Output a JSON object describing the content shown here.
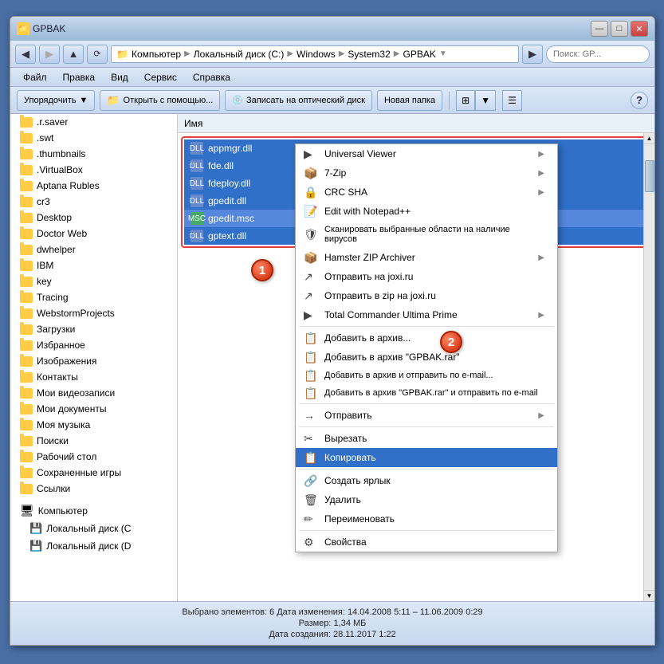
{
  "window": {
    "title": "GPBAK",
    "titlebar_buttons": {
      "minimize": "—",
      "maximize": "□",
      "close": "✕"
    }
  },
  "addressbar": {
    "path_segments": [
      "Компьютер",
      "Локальный диск (C:)",
      "Windows",
      "System32",
      "GPBAK"
    ],
    "search_placeholder": "Поиск: GP..."
  },
  "menu": {
    "items": [
      "Файл",
      "Правка",
      "Вид",
      "Сервис",
      "Справка"
    ]
  },
  "toolbar": {
    "organize": "Упорядочить",
    "open_with": "Открыть с помощью...",
    "burn": "Записать на оптический диск",
    "new_folder": "Новая папка",
    "help": "?"
  },
  "sidebar": {
    "items": [
      ".r.saver",
      ".swt",
      ".thumbnails",
      ".VirtualBox",
      "Aptana Rubles",
      "cr3",
      "Desktop",
      "Doctor Web",
      "dwhelper",
      "IBM",
      "key",
      "Tracing",
      "WebstormProjects",
      "Загрузки",
      "Избранное",
      "Изображения",
      "Контакты",
      "Мои видеозаписи",
      "Мои документы",
      "Моя музыка",
      "Поиски",
      "Рабочий стол",
      "Сохраненные игры",
      "Ссылки"
    ],
    "computer": "Компьютер",
    "drives": [
      "Локальный диск (C",
      "Локальный диск (D"
    ]
  },
  "file_list": {
    "column_header": "Имя",
    "files": [
      {
        "name": "appmgr.dll",
        "type": "dll",
        "selected": true
      },
      {
        "name": "fde.dll",
        "type": "dll",
        "selected": true
      },
      {
        "name": "fdeploy.dll",
        "type": "dll",
        "selected": true
      },
      {
        "name": "gpedit.dll",
        "type": "dll",
        "selected": true
      },
      {
        "name": "gpedit.msc",
        "type": "msc",
        "selected": true
      },
      {
        "name": "gptext.dll",
        "type": "dll",
        "selected": true
      }
    ]
  },
  "context_menu": {
    "items": [
      {
        "label": "Universal Viewer",
        "icon": "▶",
        "arrow": true
      },
      {
        "label": "7-Zip",
        "icon": "📦",
        "arrow": true
      },
      {
        "label": "CRC SHA",
        "icon": "🔒",
        "arrow": true
      },
      {
        "label": "Edit with Notepad++",
        "icon": "📝",
        "arrow": false
      },
      {
        "label": "Сканировать выбранные области на наличие вирусов",
        "icon": "🛡",
        "arrow": false
      },
      {
        "label": "Hamster ZIP Archiver",
        "icon": "📦",
        "arrow": true
      },
      {
        "label": "Отправить на joxi.ru",
        "icon": "↗",
        "arrow": false
      },
      {
        "label": "Отправить в zip на joxi.ru",
        "icon": "↗",
        "arrow": false
      },
      {
        "label": "Total Commander Ultima Prime",
        "icon": "▶",
        "arrow": true
      },
      {
        "label": "Добавить в архив...",
        "icon": "📋",
        "arrow": false
      },
      {
        "label": "Добавить в архив \"GPBAK.rar\"",
        "icon": "📋",
        "arrow": false
      },
      {
        "label": "Добавить в архив и отправить по e-mail...",
        "icon": "📋",
        "arrow": false
      },
      {
        "label": "Добавить в архив \"GPBAK.rar\" и отправить по e-mail",
        "icon": "📋",
        "arrow": false
      },
      {
        "label": "Отправить",
        "icon": "→",
        "arrow": true
      },
      {
        "label": "Вырезать",
        "icon": "✂",
        "arrow": false
      },
      {
        "label": "Копировать",
        "icon": "📋",
        "arrow": false,
        "highlighted": true
      },
      {
        "label": "Создать ярлык",
        "icon": "🔗",
        "arrow": false
      },
      {
        "label": "Удалить",
        "icon": "🗑",
        "arrow": false
      },
      {
        "label": "Переименовать",
        "icon": "✏",
        "arrow": false
      },
      {
        "label": "Свойства",
        "icon": "⚙",
        "arrow": false
      }
    ]
  },
  "status_bar": {
    "line1": "Выбрано элементов: 6   Дата изменения: 14.04.2008 5:11 – 11.06.2009 0:29",
    "line2": "Размер: 1,34 МБ",
    "line3": "Дата создания: 28.11.2017 1:22"
  },
  "badges": {
    "badge1": "1",
    "badge2": "2"
  }
}
